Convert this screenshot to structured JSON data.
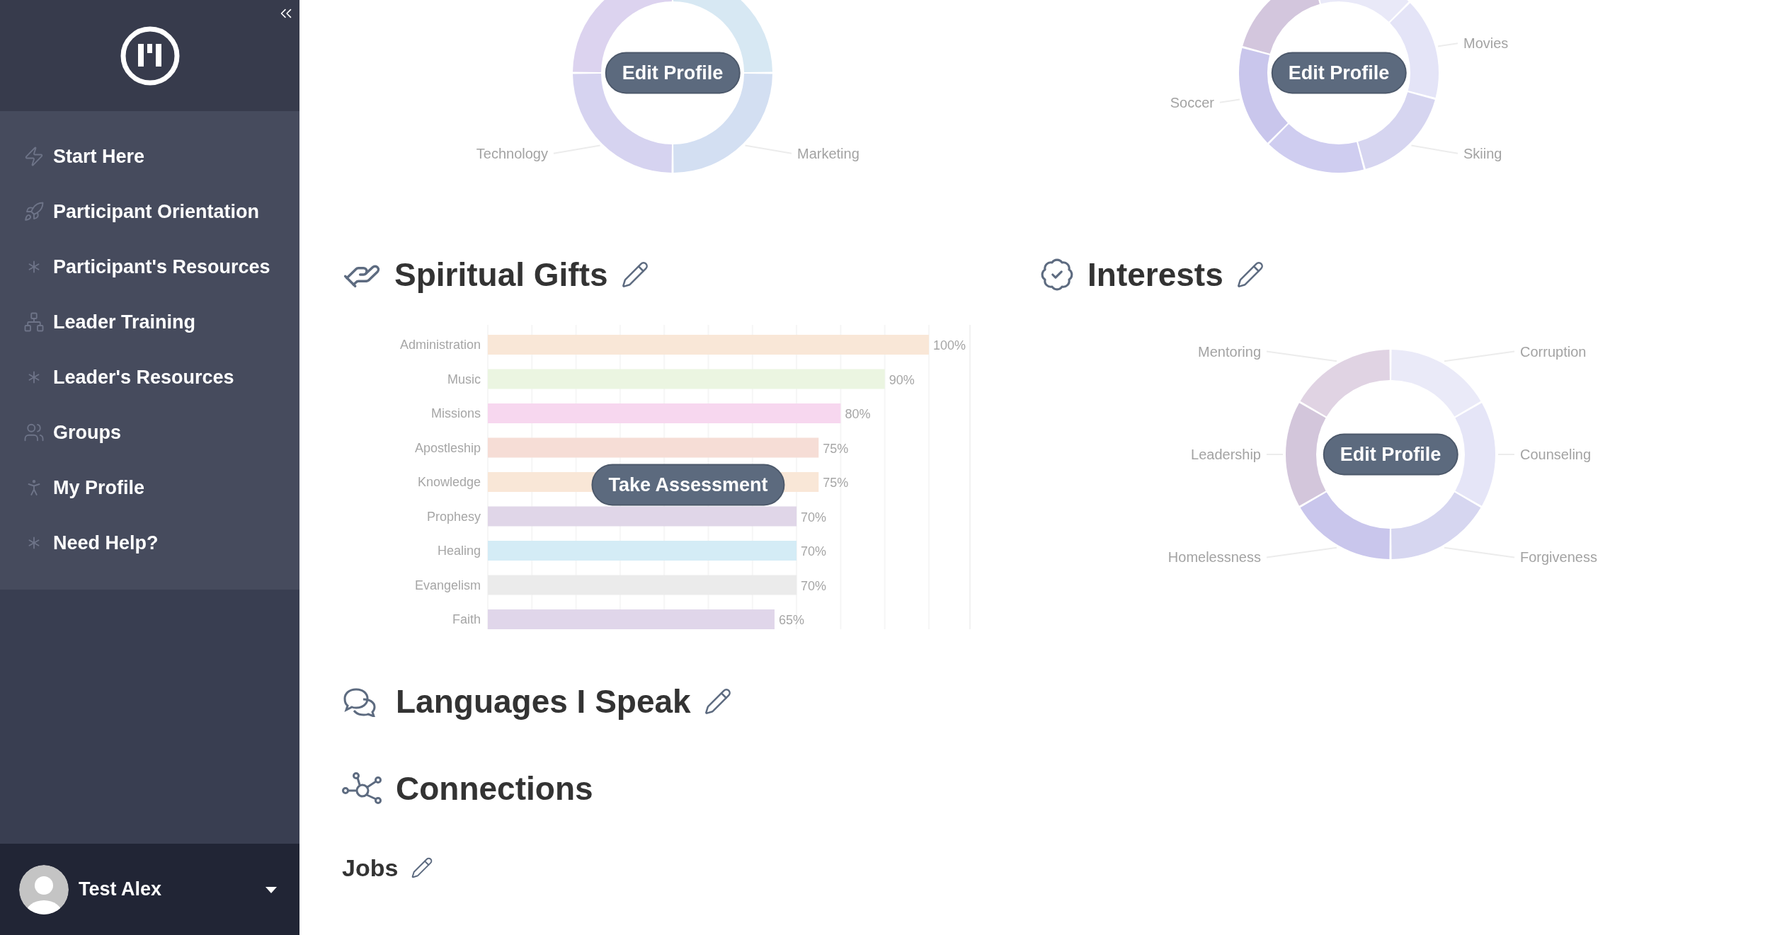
{
  "sidebar": {
    "items": [
      {
        "label": "Start Here"
      },
      {
        "label": "Participant Orientation"
      },
      {
        "label": "Participant's Resources"
      },
      {
        "label": "Leader Training"
      },
      {
        "label": "Leader's Resources"
      },
      {
        "label": "Groups"
      },
      {
        "label": "My Profile"
      },
      {
        "label": "Need Help?"
      }
    ],
    "user": {
      "name": "Test Alex"
    }
  },
  "top_charts": [
    {
      "button": "Edit Profile",
      "segments": [
        {
          "color": "#dcd3ef"
        },
        {
          "color": "#d7e8f3"
        },
        {
          "label": "Technology",
          "color": "#d6d3f0"
        },
        {
          "label": "Marketing",
          "color": "#d3dff2"
        }
      ]
    },
    {
      "button": "Edit Profile",
      "segments": [
        {
          "color": "#d3c6dd"
        },
        {
          "color": "#e9e9f8"
        },
        {
          "label": "Soccer",
          "color": "#c9c6ec"
        },
        {
          "label": "Movies",
          "color": "#e4e4f7"
        },
        {
          "color": "#cfcdf0"
        },
        {
          "label": "Skiing",
          "color": "#d6d5f0"
        }
      ]
    }
  ],
  "spiritual_gifts": {
    "title": "Spiritual Gifts",
    "button": "Take Assessment",
    "bars": [
      {
        "color": "#f9e7d7"
      },
      {
        "color": "#ebf5e1"
      },
      {
        "color": "#f7d7ef"
      },
      {
        "color": "#f6ddd6"
      },
      {
        "color": "#f9e7d7"
      },
      {
        "color": "#e0d6e8"
      },
      {
        "color": "#d4ecf6"
      },
      {
        "color": "#ebebeb"
      },
      {
        "color": "#e0d6ea"
      }
    ],
    "chart_data": {
      "type": "bar",
      "orientation": "horizontal",
      "categories": [
        "Administration",
        "Music",
        "Missions",
        "Apostleship",
        "Knowledge",
        "Prophesy",
        "Healing",
        "Evangelism",
        "Faith"
      ],
      "series": [
        {
          "values": [
            100,
            90,
            80,
            75,
            75,
            70,
            70,
            70,
            65
          ],
          "value_labels": [
            "100%",
            "90%",
            "80%",
            "75%",
            "75%",
            "70%",
            "70%",
            "70%",
            "65%"
          ]
        }
      ]
    }
  },
  "interests": {
    "title": "Interests",
    "button": "Edit Profile",
    "segments": [
      {
        "label": "Mentoring",
        "color": "#e0d3e3"
      },
      {
        "label": "Corruption",
        "color": "#eaeaf8"
      },
      {
        "label": "Leadership",
        "color": "#d3c6db"
      },
      {
        "label": "Counseling",
        "color": "#e5e5f7"
      },
      {
        "label": "Homelessness",
        "color": "#c9c6ec"
      },
      {
        "label": "Forgiveness",
        "color": "#d6d6f0"
      }
    ]
  },
  "languages": {
    "title": "Languages I Speak"
  },
  "connections": {
    "title": "Connections",
    "items": [
      {
        "title": "Jobs"
      }
    ]
  }
}
